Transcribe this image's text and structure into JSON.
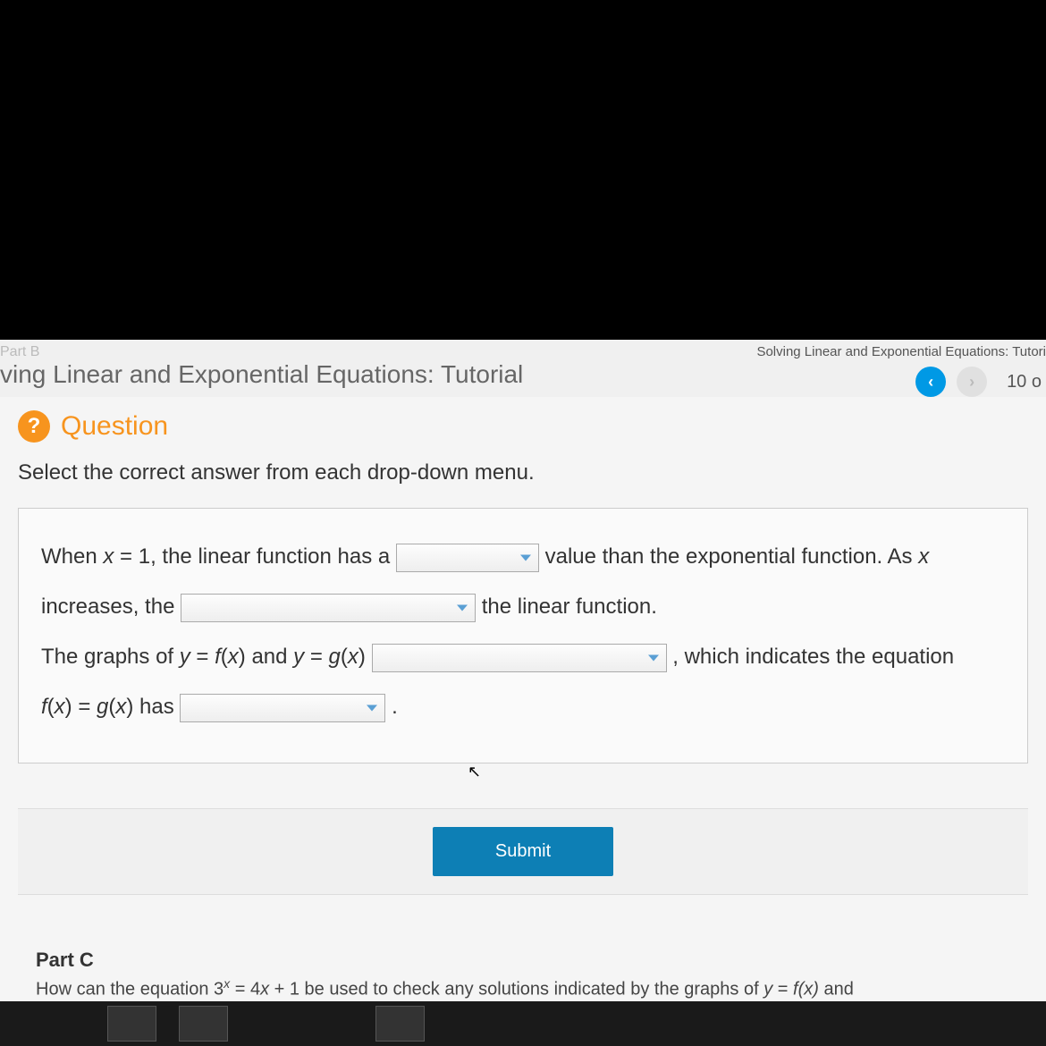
{
  "header": {
    "part_label": "Part B",
    "tutorial_title": "ving Linear and Exponential Equations: Tutorial",
    "breadcrumb": "Solving Linear and Exponential Equations: Tutori",
    "page_count": "10 o"
  },
  "question": {
    "label": "Question",
    "icon": "?",
    "instruction": "Select the correct answer from each drop-down menu.",
    "line1_prefix": "When ",
    "line1_var": "x",
    "line1_mid": " = 1, the linear function has a ",
    "line1_after": "value than the exponential function. As ",
    "line1_var2": "x",
    "line2_prefix": "increases, the ",
    "line2_after": "the linear function.",
    "line3_prefix": "The graphs of ",
    "line3_y1": "y",
    "line3_eq1": " = ",
    "line3_fx": "f",
    "line3_paren1": "(",
    "line3_x1": "x",
    "line3_paren2": ") and ",
    "line3_y2": "y",
    "line3_eq2": " = ",
    "line3_gx": "g",
    "line3_paren3": "(",
    "line3_x2": "x",
    "line3_paren4": ") ",
    "line3_after": ", which indicates the equation",
    "line4_fx": "f",
    "line4_p1": "(",
    "line4_x": "x",
    "line4_p2": ") = ",
    "line4_gx": "g",
    "line4_p3": "(",
    "line4_x2": "x",
    "line4_p4": ") has ",
    "line4_period": "."
  },
  "submit": {
    "label": "Submit"
  },
  "partc": {
    "title": "Part C",
    "text_prefix": "How can the equation 3",
    "text_exp": "x",
    "text_mid": " = 4",
    "text_x": "x",
    "text_after": " + 1 be used to check any solutions indicated by the graphs of ",
    "text_y": "y",
    "text_eq": " = ",
    "text_fx": "f(x)",
    "text_and": " and"
  }
}
